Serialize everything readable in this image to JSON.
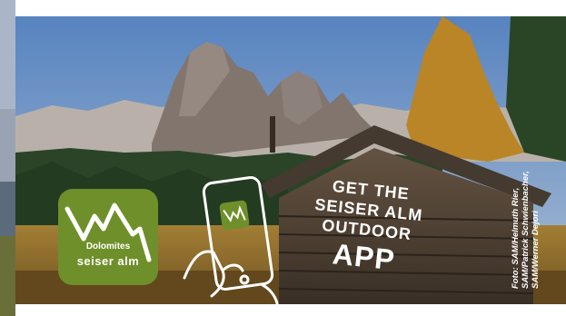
{
  "ad": {
    "logo": {
      "subtitle": "Dolomites",
      "name": "seiser alm"
    },
    "cta": {
      "line1": "GET THE",
      "line2": "SEISER ALM",
      "line3": "OUTDOOR",
      "line4": "APP"
    },
    "credit": {
      "line1": "Foto: SAM/Helmuth Rier,",
      "line2": "SAM/Patrick Schwienbacher,",
      "line3": "SAM/Werner Dejori"
    }
  },
  "colors": {
    "brand_green": "#6f8f2a",
    "sky": "#7fa8d8",
    "white": "#ffffff"
  },
  "icons": [
    "mountain-logo-icon",
    "phone-hand-icon"
  ]
}
